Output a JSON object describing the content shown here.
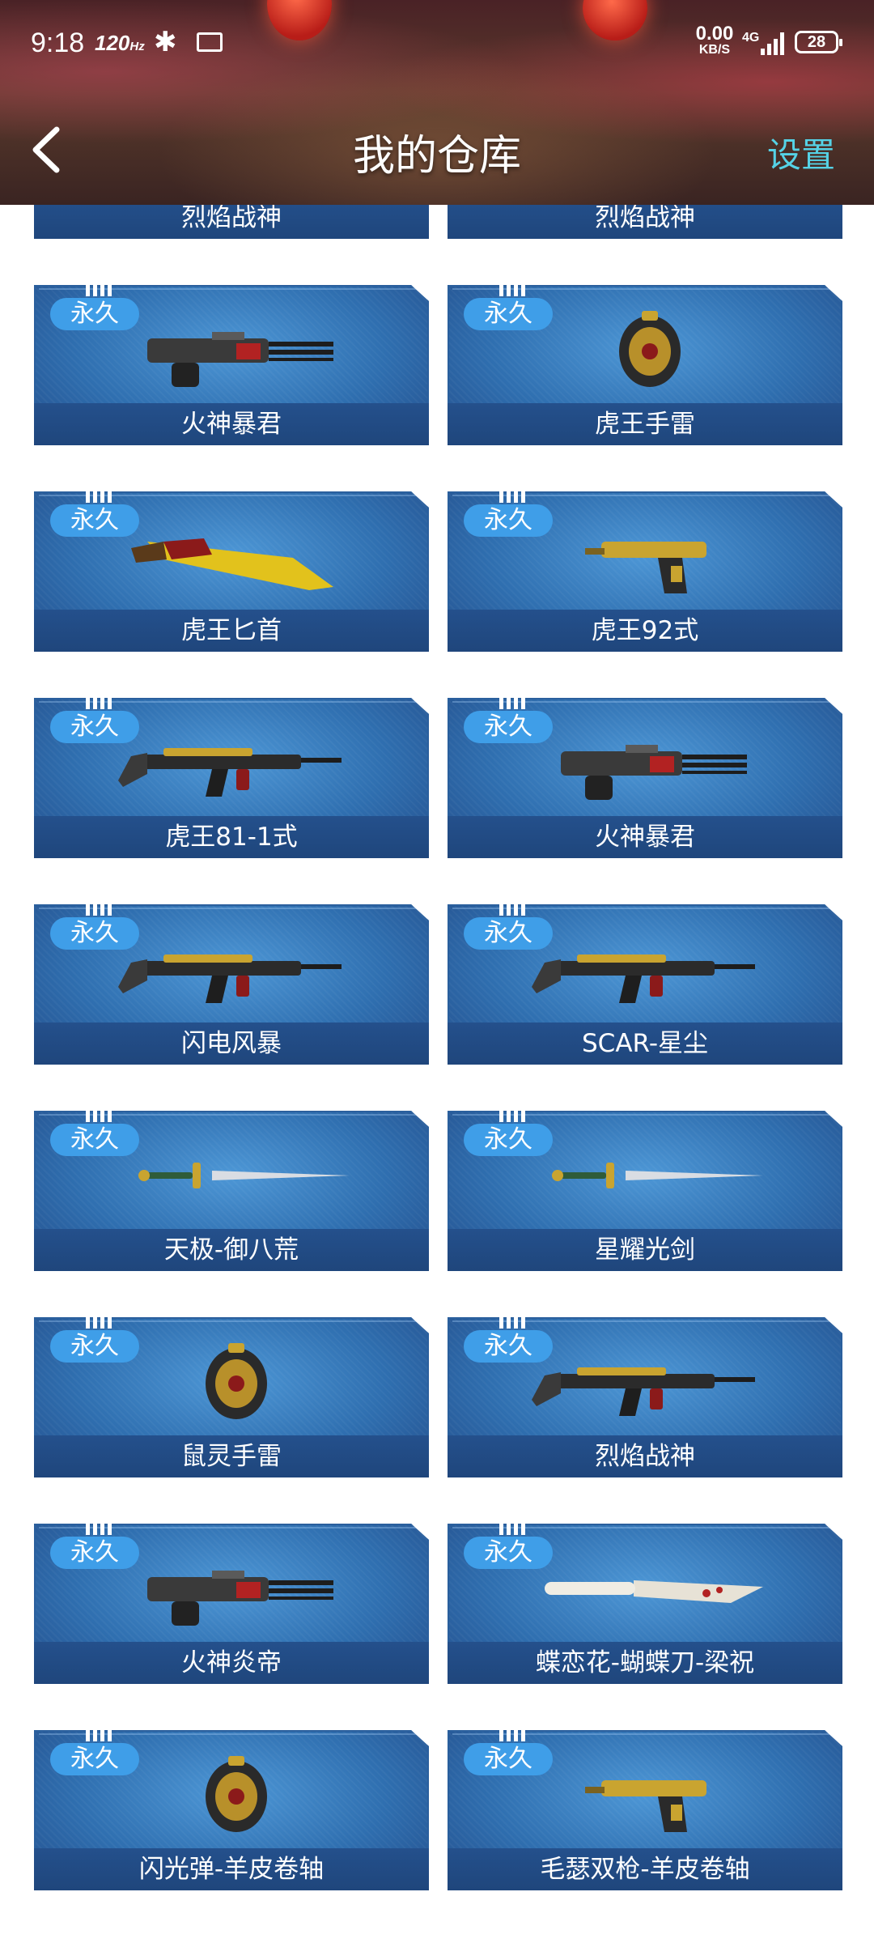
{
  "status_bar": {
    "time": "9:18",
    "refresh_rate": "120",
    "refresh_rate_unit": "Hz",
    "net_speed": "0.00",
    "net_speed_unit": "KB/S",
    "network_type": "4G",
    "battery": "28"
  },
  "header": {
    "title": "我的仓库",
    "settings_label": "设置"
  },
  "cards": [
    {
      "name": "烈焰战神",
      "icon": "rifle-icon"
    },
    {
      "name": "烈焰战神",
      "icon": "rifle-icon"
    },
    {
      "badge": "永久",
      "name": "火神暴君",
      "icon": "gatling-gun-icon"
    },
    {
      "badge": "永久",
      "name": "虎王手雷",
      "icon": "grenade-icon"
    },
    {
      "badge": "永久",
      "name": "虎王匕首",
      "icon": "dagger-icon"
    },
    {
      "badge": "永久",
      "name": "虎王92式",
      "icon": "pistol-icon"
    },
    {
      "badge": "永久",
      "name": "虎王81-1式",
      "icon": "rifle-icon"
    },
    {
      "badge": "永久",
      "name": "火神暴君",
      "icon": "gatling-gun-icon"
    },
    {
      "badge": "永久",
      "name": "闪电风暴",
      "icon": "rifle-icon"
    },
    {
      "badge": "永久",
      "name": "SCAR-星尘",
      "icon": "rifle-icon"
    },
    {
      "badge": "永久",
      "name": "天极-御八荒",
      "icon": "sword-icon"
    },
    {
      "badge": "永久",
      "name": "星耀光剑",
      "icon": "sword-icon"
    },
    {
      "badge": "永久",
      "name": "鼠灵手雷",
      "icon": "grenade-icon"
    },
    {
      "badge": "永久",
      "name": "烈焰战神",
      "icon": "rifle-icon"
    },
    {
      "badge": "永久",
      "name": "火神炎帝",
      "icon": "gatling-gun-icon"
    },
    {
      "badge": "永久",
      "name": "蝶恋花-蝴蝶刀-梁祝",
      "icon": "knife-icon"
    },
    {
      "badge": "永久",
      "name": "闪光弹-羊皮卷轴",
      "icon": "grenade-icon"
    },
    {
      "badge": "永久",
      "name": "毛瑟双枪-羊皮卷轴",
      "icon": "pistol-icon"
    }
  ]
}
